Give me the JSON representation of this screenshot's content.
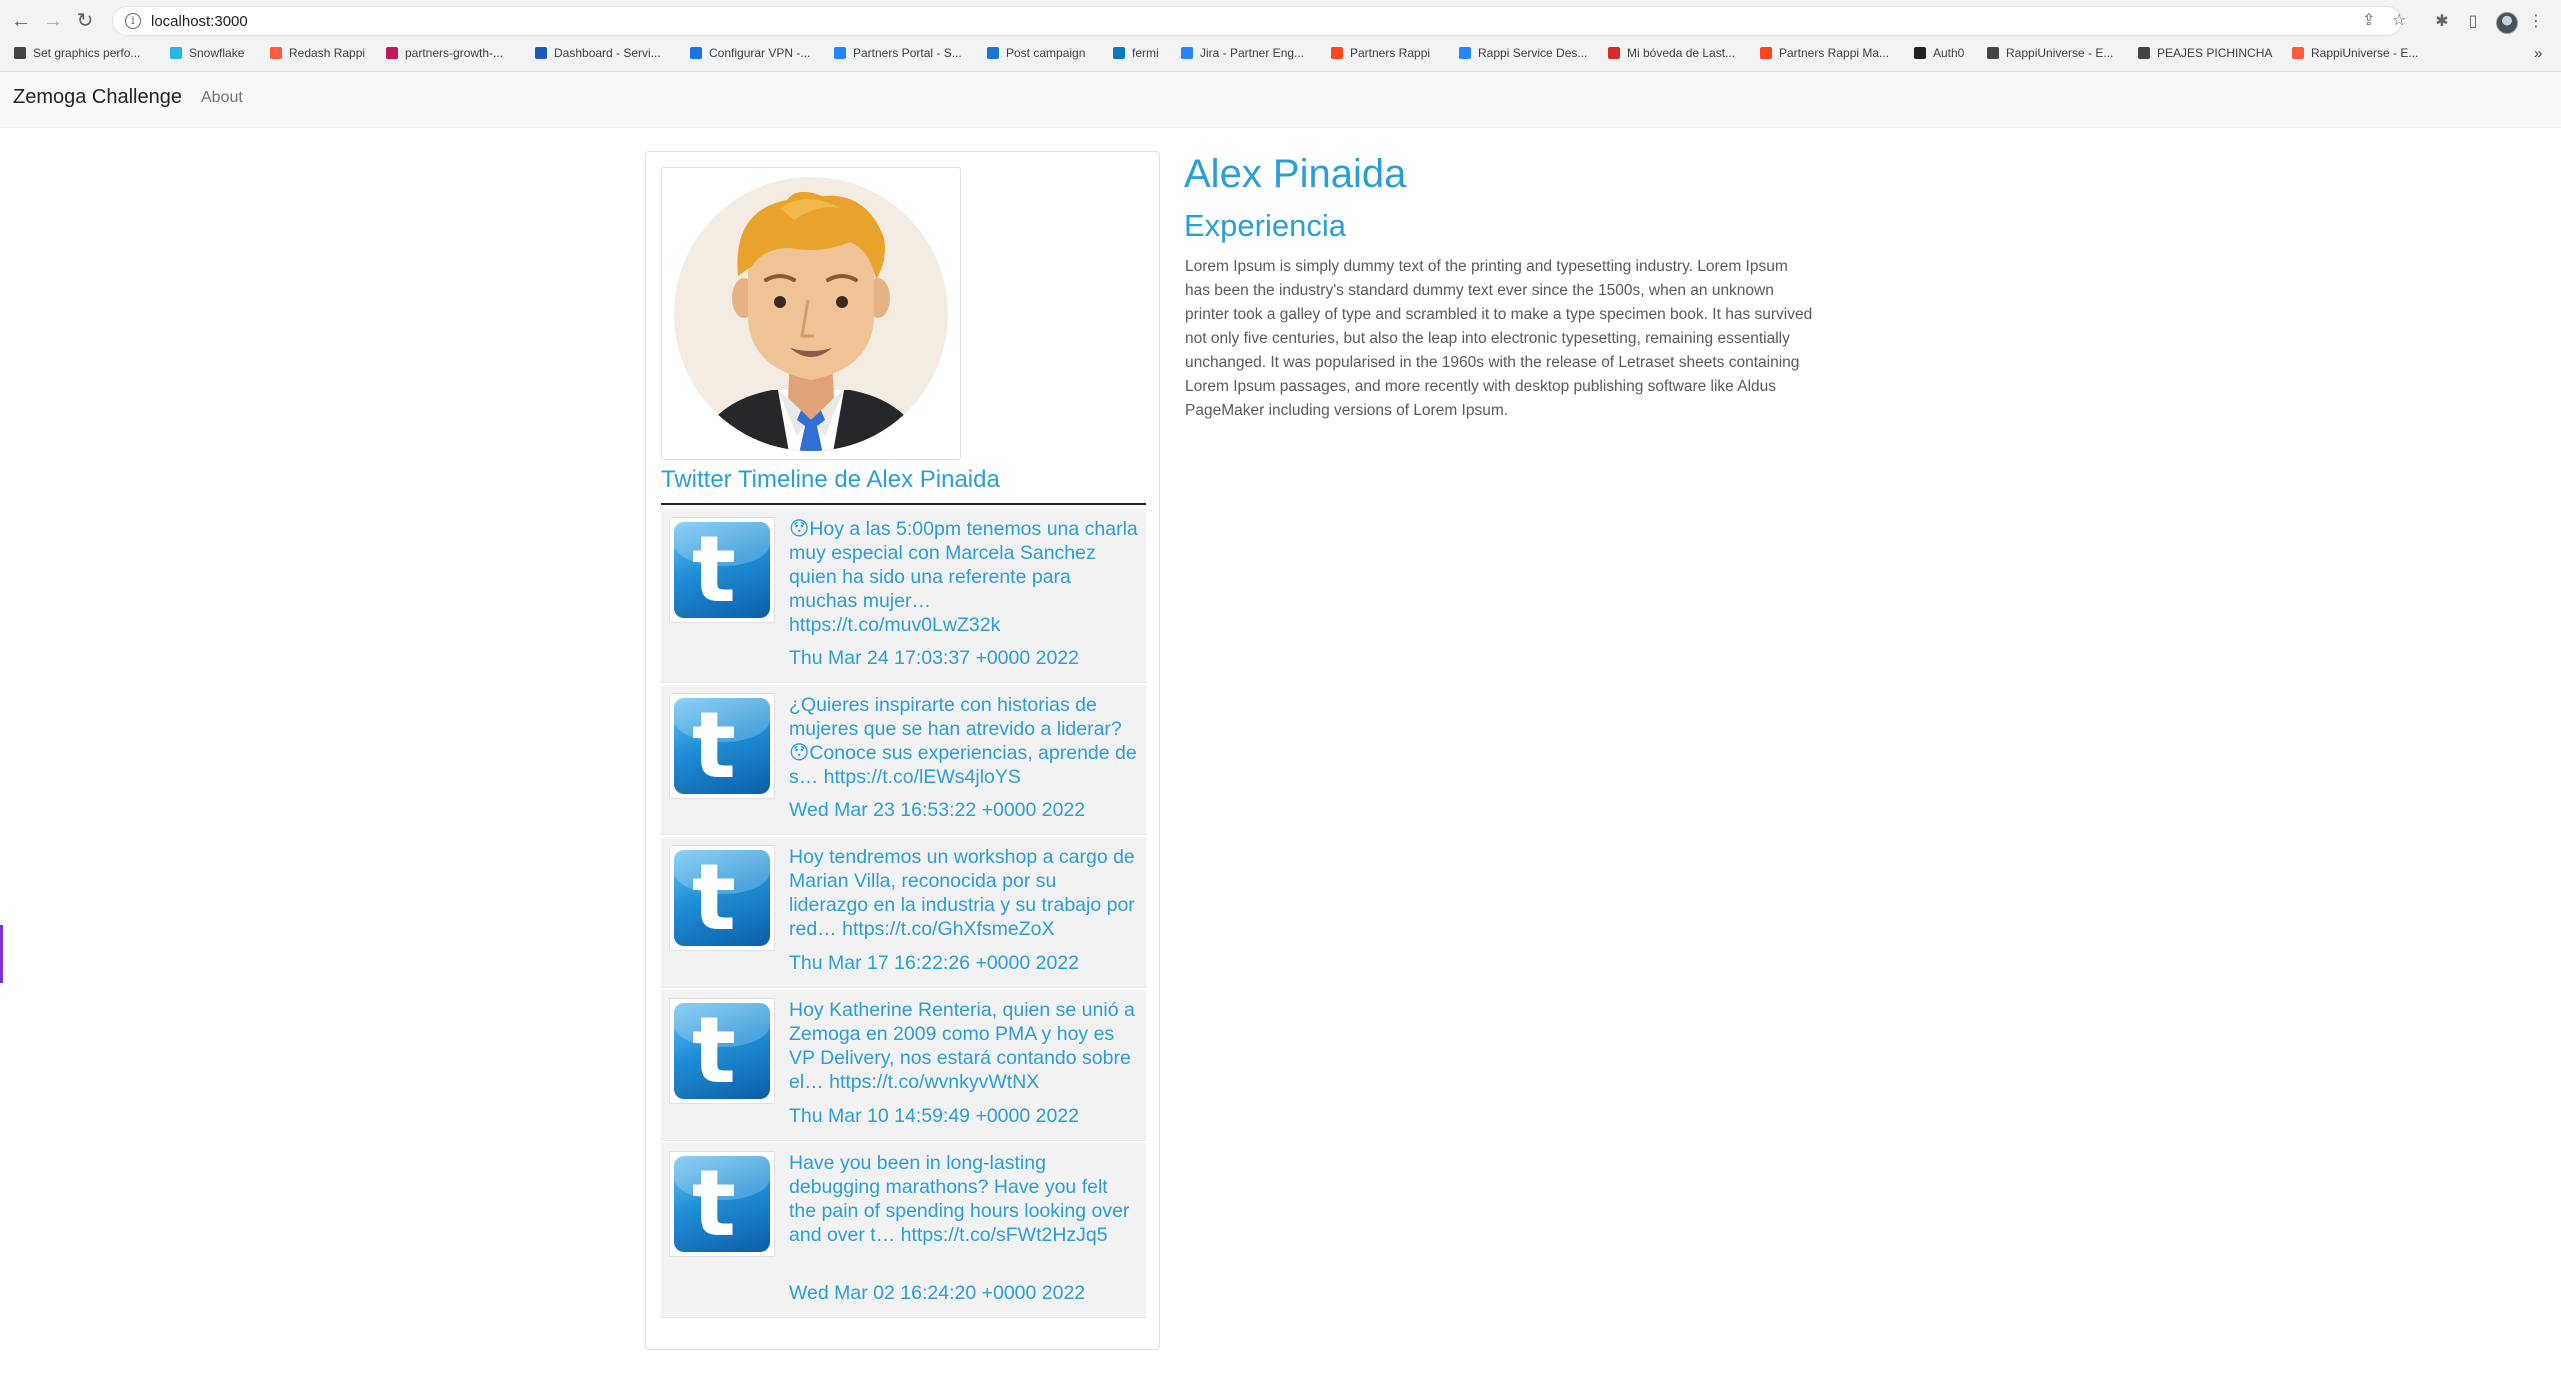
{
  "browser": {
    "url": "localhost:3000",
    "bookmarks": [
      {
        "label": "Set graphics perfo...",
        "color": "#444444"
      },
      {
        "label": "Snowflake",
        "color": "#29b5e8"
      },
      {
        "label": "Redash Rappi",
        "color": "#ff5a3c"
      },
      {
        "label": "partners-growth-...",
        "color": "#c2185b"
      },
      {
        "label": "Dashboard - Servi...",
        "color": "#1e5bb8"
      },
      {
        "label": "Configurar VPN -...",
        "color": "#1a73e8"
      },
      {
        "label": "Partners Portal - S...",
        "color": "#2684ff"
      },
      {
        "label": "Post campaign",
        "color": "#1976d2"
      },
      {
        "label": "fermi",
        "color": "#0b7bbd"
      },
      {
        "label": "Jira - Partner Eng...",
        "color": "#2684ff"
      },
      {
        "label": "Partners Rappi",
        "color": "#ff441f"
      },
      {
        "label": "Rappi Service Des...",
        "color": "#2684ff"
      },
      {
        "label": "Mi bóveda de Last...",
        "color": "#d32d27"
      },
      {
        "label": "Partners Rappi Ma...",
        "color": "#ff441f"
      },
      {
        "label": "Auth0",
        "color": "#222222"
      },
      {
        "label": "RappiUniverse - E...",
        "color": "#444444"
      },
      {
        "label": "PEAJES PICHINCHA",
        "color": "#444444"
      },
      {
        "label": "RappiUniverse - E...",
        "color": "#ff5a3c"
      }
    ],
    "more_bookmarks": "»"
  },
  "navbar": {
    "brand": "Zemoga Challenge",
    "about": "About"
  },
  "profile": {
    "name": "Alex Pinaida",
    "experience_title": "Experiencia",
    "experience_text": "Lorem Ipsum is simply dummy text of the printing and typesetting industry. Lorem Ipsum has been the industry's standard dummy text ever since the 1500s, when an unknown printer took a galley of type and scrambled it to make a type specimen book. It has survived not only five centuries, but also the leap into electronic typesetting, remaining essentially unchanged. It was popularised in the 1960s with the release of Letraset sheets containing Lorem Ipsum passages, and more recently with desktop publishing software like Aldus PageMaker including versions of Lorem Ipsum."
  },
  "timeline": {
    "title": "Twitter Timeline de Alex Pinaida",
    "tweets": [
      {
        "text": "😯Hoy a las 5:00pm tenemos una charla muy especial con Marcela Sanchez quien ha sido una referente para muchas mujer… https://t.co/muv0LwZ32k",
        "date": "Thu Mar 24 17:03:37 +0000 2022"
      },
      {
        "text": "¿Quieres inspirarte con historias de mujeres que se han atrevido a liderar? 😯Conoce sus experiencias, aprende de s… https://t.co/lEWs4jloYS",
        "date": "Wed Mar 23 16:53:22 +0000 2022"
      },
      {
        "text": "Hoy tendremos un workshop a cargo de Marian Villa, reconocida por su liderazgo en la industria y su trabajo por red… https://t.co/GhXfsmeZoX",
        "date": "Thu Mar 17 16:22:26 +0000 2022"
      },
      {
        "text": "Hoy Katherine Renteria, quien se unió a Zemoga en 2009 como PMA y hoy es VP Delivery, nos estará contando sobre el… https://t.co/wvnkyvWtNX",
        "date": "Thu Mar 10 14:59:49 +0000 2022"
      },
      {
        "text": "Have you been in long-lasting debugging marathons? Have you felt the pain of spending hours looking over and over t… https://t.co/sFWt2HzJq5",
        "date": "Wed Mar 02 16:24:20 +0000 2022"
      }
    ]
  }
}
